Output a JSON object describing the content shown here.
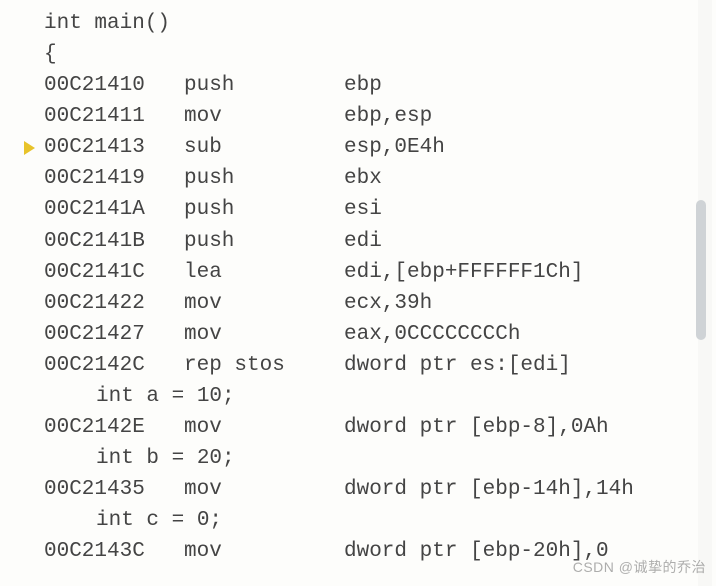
{
  "source": {
    "func_sig": "int main()",
    "open_brace": "{",
    "decl_a": "int a = 10;",
    "decl_b": "int b = 20;",
    "decl_c": "int c = 0;"
  },
  "rows": [
    {
      "addr": "00C21410",
      "opc": "push",
      "opd": "ebp"
    },
    {
      "addr": "00C21411",
      "opc": "mov",
      "opd": "ebp,esp"
    },
    {
      "addr": "00C21413",
      "opc": "sub",
      "opd": "esp,0E4h"
    },
    {
      "addr": "00C21419",
      "opc": "push",
      "opd": "ebx"
    },
    {
      "addr": "00C2141A",
      "opc": "push",
      "opd": "esi"
    },
    {
      "addr": "00C2141B",
      "opc": "push",
      "opd": "edi"
    },
    {
      "addr": "00C2141C",
      "opc": "lea",
      "opd": "edi,[ebp+FFFFFF1Ch]"
    },
    {
      "addr": "00C21422",
      "opc": "mov",
      "opd": "ecx,39h"
    },
    {
      "addr": "00C21427",
      "opc": "mov",
      "opd": "eax,0CCCCCCCCh"
    },
    {
      "addr": "00C2142C",
      "opc": "rep stos",
      "opd": "dword ptr es:[edi]"
    },
    {
      "addr": "00C2142E",
      "opc": "mov",
      "opd": "dword ptr [ebp-8],0Ah"
    },
    {
      "addr": "00C21435",
      "opc": "mov",
      "opd": "dword ptr [ebp-14h],14h"
    },
    {
      "addr": "00C2143C",
      "opc": "mov",
      "opd": "dword ptr [ebp-20h],0"
    }
  ],
  "watermark": "CSDN @诚挚的乔治"
}
